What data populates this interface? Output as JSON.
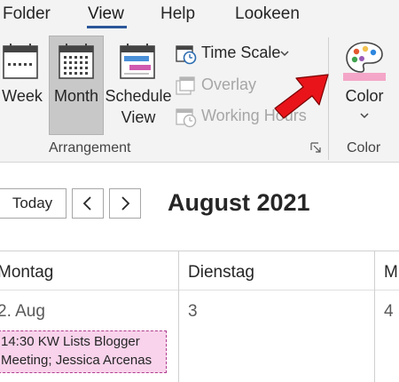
{
  "ribbon": {
    "tabs": [
      {
        "label": "Folder"
      },
      {
        "label": "View"
      },
      {
        "label": "Help"
      },
      {
        "label": "Lookeen"
      }
    ],
    "active_tab": "View",
    "accent_color": "#2b579a",
    "arrangement": {
      "week_label": "Week",
      "month_label": "Month",
      "schedule_label_line1": "Schedule",
      "schedule_label_line2": "View",
      "time_scale_label": "Time Scale",
      "overlay_label": "Overlay",
      "working_hours_label": "Working Hours",
      "group_label": "Arrangement"
    },
    "color": {
      "button_label": "Color",
      "group_label": "Color",
      "swatch_color": "#f4a6c8"
    }
  },
  "calendar": {
    "today_label": "Today",
    "prev_label": "<",
    "next_label": ">",
    "month_title": "August 2021",
    "days": [
      {
        "name": "Montag",
        "date": "2. Aug"
      },
      {
        "name": "Dienstag",
        "date": "3"
      },
      {
        "name": "M",
        "date": "4"
      }
    ],
    "event": {
      "line1": "14:30 KW Lists Blogger",
      "line2": "Meeting; Jessica Arcenas",
      "color": "#f8d3eb"
    }
  }
}
